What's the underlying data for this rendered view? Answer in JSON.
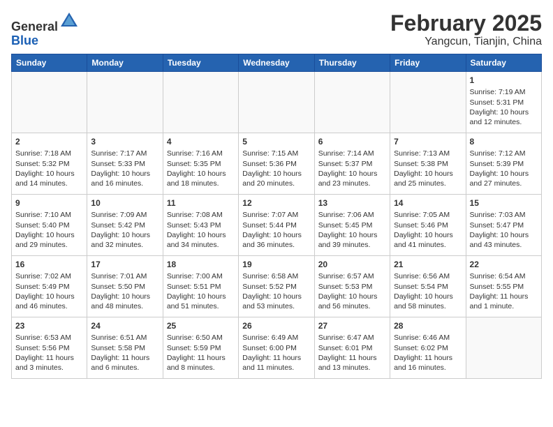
{
  "header": {
    "logo_general": "General",
    "logo_blue": "Blue",
    "title": "February 2025",
    "subtitle": "Yangcun, Tianjin, China"
  },
  "days_of_week": [
    "Sunday",
    "Monday",
    "Tuesday",
    "Wednesday",
    "Thursday",
    "Friday",
    "Saturday"
  ],
  "weeks": [
    [
      {
        "day": "",
        "info": ""
      },
      {
        "day": "",
        "info": ""
      },
      {
        "day": "",
        "info": ""
      },
      {
        "day": "",
        "info": ""
      },
      {
        "day": "",
        "info": ""
      },
      {
        "day": "",
        "info": ""
      },
      {
        "day": "1",
        "info": "Sunrise: 7:19 AM\nSunset: 5:31 PM\nDaylight: 10 hours\nand 12 minutes."
      }
    ],
    [
      {
        "day": "2",
        "info": "Sunrise: 7:18 AM\nSunset: 5:32 PM\nDaylight: 10 hours\nand 14 minutes."
      },
      {
        "day": "3",
        "info": "Sunrise: 7:17 AM\nSunset: 5:33 PM\nDaylight: 10 hours\nand 16 minutes."
      },
      {
        "day": "4",
        "info": "Sunrise: 7:16 AM\nSunset: 5:35 PM\nDaylight: 10 hours\nand 18 minutes."
      },
      {
        "day": "5",
        "info": "Sunrise: 7:15 AM\nSunset: 5:36 PM\nDaylight: 10 hours\nand 20 minutes."
      },
      {
        "day": "6",
        "info": "Sunrise: 7:14 AM\nSunset: 5:37 PM\nDaylight: 10 hours\nand 23 minutes."
      },
      {
        "day": "7",
        "info": "Sunrise: 7:13 AM\nSunset: 5:38 PM\nDaylight: 10 hours\nand 25 minutes."
      },
      {
        "day": "8",
        "info": "Sunrise: 7:12 AM\nSunset: 5:39 PM\nDaylight: 10 hours\nand 27 minutes."
      }
    ],
    [
      {
        "day": "9",
        "info": "Sunrise: 7:10 AM\nSunset: 5:40 PM\nDaylight: 10 hours\nand 29 minutes."
      },
      {
        "day": "10",
        "info": "Sunrise: 7:09 AM\nSunset: 5:42 PM\nDaylight: 10 hours\nand 32 minutes."
      },
      {
        "day": "11",
        "info": "Sunrise: 7:08 AM\nSunset: 5:43 PM\nDaylight: 10 hours\nand 34 minutes."
      },
      {
        "day": "12",
        "info": "Sunrise: 7:07 AM\nSunset: 5:44 PM\nDaylight: 10 hours\nand 36 minutes."
      },
      {
        "day": "13",
        "info": "Sunrise: 7:06 AM\nSunset: 5:45 PM\nDaylight: 10 hours\nand 39 minutes."
      },
      {
        "day": "14",
        "info": "Sunrise: 7:05 AM\nSunset: 5:46 PM\nDaylight: 10 hours\nand 41 minutes."
      },
      {
        "day": "15",
        "info": "Sunrise: 7:03 AM\nSunset: 5:47 PM\nDaylight: 10 hours\nand 43 minutes."
      }
    ],
    [
      {
        "day": "16",
        "info": "Sunrise: 7:02 AM\nSunset: 5:49 PM\nDaylight: 10 hours\nand 46 minutes."
      },
      {
        "day": "17",
        "info": "Sunrise: 7:01 AM\nSunset: 5:50 PM\nDaylight: 10 hours\nand 48 minutes."
      },
      {
        "day": "18",
        "info": "Sunrise: 7:00 AM\nSunset: 5:51 PM\nDaylight: 10 hours\nand 51 minutes."
      },
      {
        "day": "19",
        "info": "Sunrise: 6:58 AM\nSunset: 5:52 PM\nDaylight: 10 hours\nand 53 minutes."
      },
      {
        "day": "20",
        "info": "Sunrise: 6:57 AM\nSunset: 5:53 PM\nDaylight: 10 hours\nand 56 minutes."
      },
      {
        "day": "21",
        "info": "Sunrise: 6:56 AM\nSunset: 5:54 PM\nDaylight: 10 hours\nand 58 minutes."
      },
      {
        "day": "22",
        "info": "Sunrise: 6:54 AM\nSunset: 5:55 PM\nDaylight: 11 hours\nand 1 minute."
      }
    ],
    [
      {
        "day": "23",
        "info": "Sunrise: 6:53 AM\nSunset: 5:56 PM\nDaylight: 11 hours\nand 3 minutes."
      },
      {
        "day": "24",
        "info": "Sunrise: 6:51 AM\nSunset: 5:58 PM\nDaylight: 11 hours\nand 6 minutes."
      },
      {
        "day": "25",
        "info": "Sunrise: 6:50 AM\nSunset: 5:59 PM\nDaylight: 11 hours\nand 8 minutes."
      },
      {
        "day": "26",
        "info": "Sunrise: 6:49 AM\nSunset: 6:00 PM\nDaylight: 11 hours\nand 11 minutes."
      },
      {
        "day": "27",
        "info": "Sunrise: 6:47 AM\nSunset: 6:01 PM\nDaylight: 11 hours\nand 13 minutes."
      },
      {
        "day": "28",
        "info": "Sunrise: 6:46 AM\nSunset: 6:02 PM\nDaylight: 11 hours\nand 16 minutes."
      },
      {
        "day": "",
        "info": ""
      }
    ]
  ]
}
